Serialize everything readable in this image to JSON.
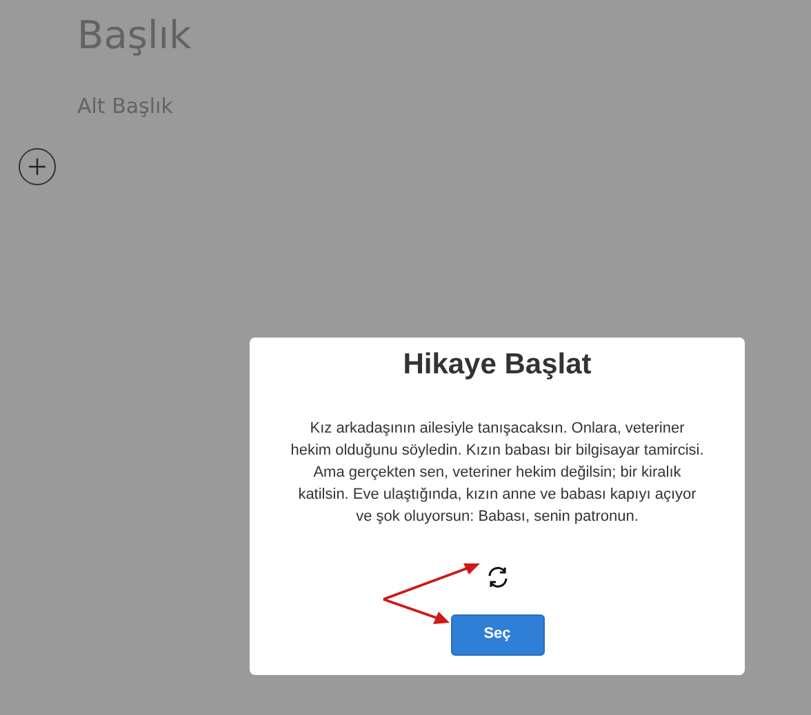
{
  "page": {
    "title": "Başlık",
    "subtitle": "Alt Başlık"
  },
  "modal": {
    "title": "Hikaye Başlat",
    "story": "Kız arkadaşının ailesiyle tanışacaksın. Onlara, veteriner hekim olduğunu söyledin. Kızın babası bir bilgisayar tamircisi. Ama gerçekten sen, veteriner hekim değilsin; bir kiralık katilsin. Eve ulaştığında, kızın anne ve babası kapıyı açıyor ve şok oluyorsun: Babası, senin patronun.",
    "button": "Seç"
  }
}
